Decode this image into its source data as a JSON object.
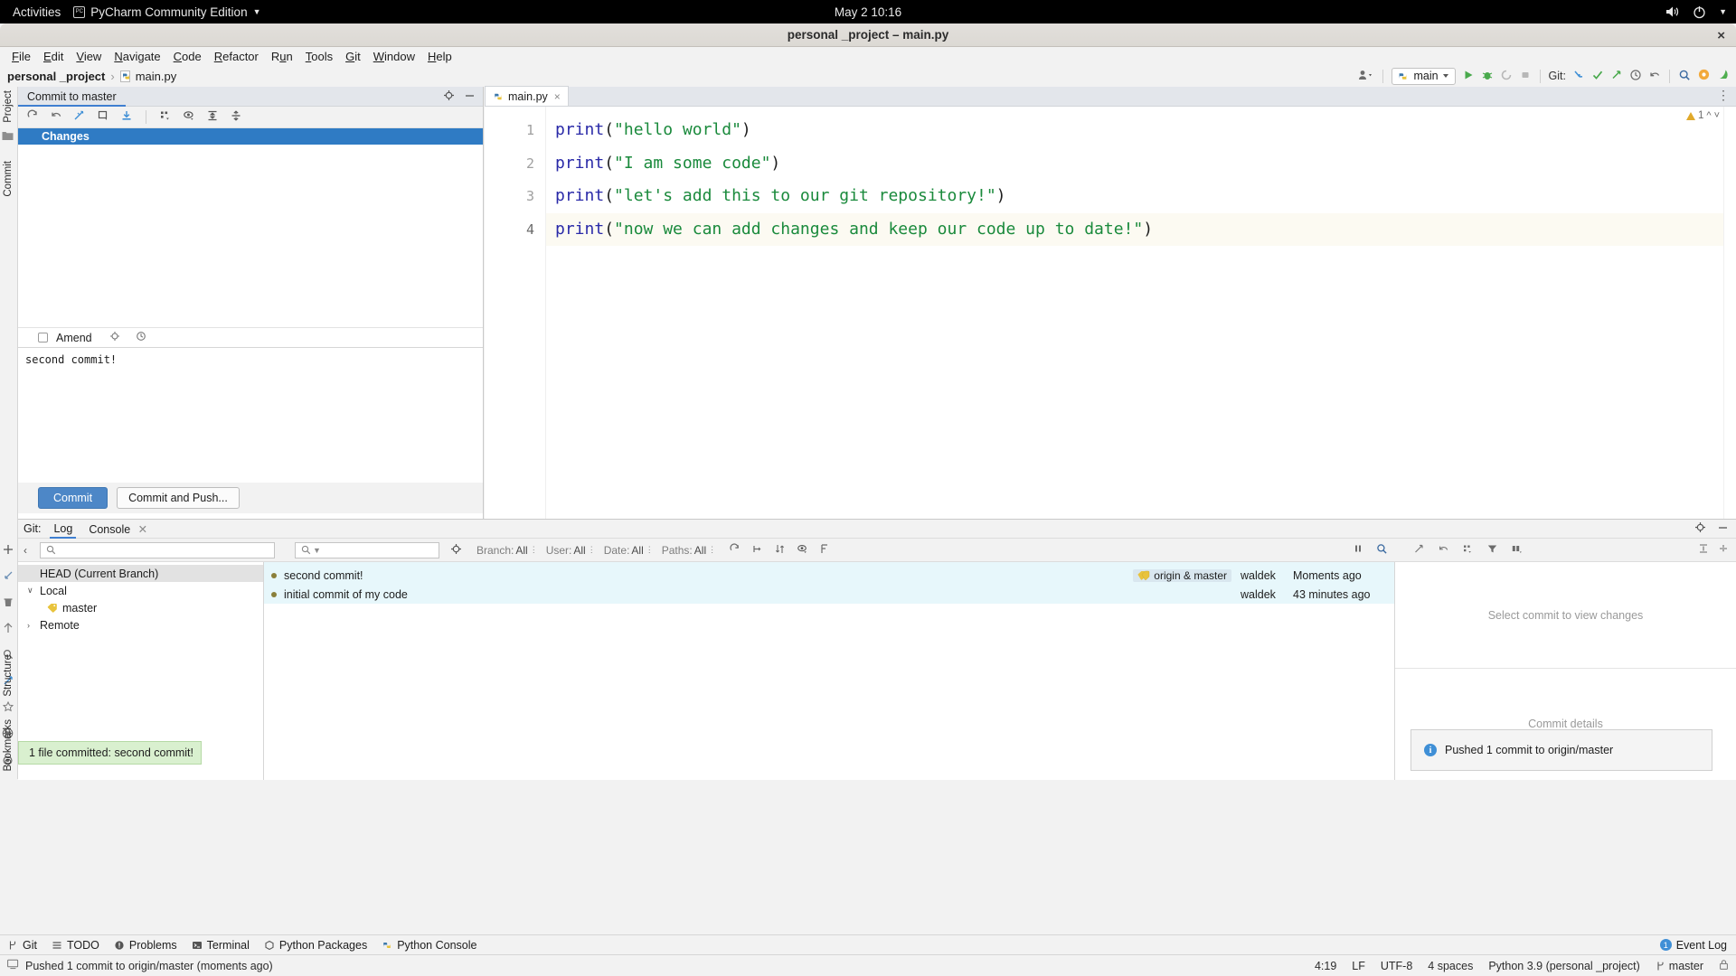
{
  "gnome": {
    "activities": "Activities",
    "app_name": "PyCharm Community Edition",
    "app_icon": "pycharm-icon",
    "clock": "May 2  10:16",
    "volume_icon": "volume-icon",
    "power_icon": "power-icon",
    "dropdown_icon": "chevron-down-icon"
  },
  "window": {
    "title": "personal _project – main.py",
    "close_label": "×"
  },
  "menubar": [
    {
      "label": "File",
      "mnemonic": "F"
    },
    {
      "label": "Edit",
      "mnemonic": "E"
    },
    {
      "label": "View",
      "mnemonic": "V"
    },
    {
      "label": "Navigate",
      "mnemonic": "N"
    },
    {
      "label": "Code",
      "mnemonic": "C"
    },
    {
      "label": "Refactor",
      "mnemonic": "R"
    },
    {
      "label": "Run",
      "mnemonic": "u"
    },
    {
      "label": "Tools",
      "mnemonic": "T"
    },
    {
      "label": "Git",
      "mnemonic": "G"
    },
    {
      "label": "Window",
      "mnemonic": "W"
    },
    {
      "label": "Help",
      "mnemonic": "H"
    }
  ],
  "breadcrumb": {
    "project": "personal _project",
    "separator": "›",
    "file": "main.py"
  },
  "toolbar": {
    "run_config": "main",
    "git_label": "Git:",
    "icons": [
      "person-dropdown-icon",
      "run-icon",
      "debug-icon",
      "coverage-icon",
      "stop-icon",
      "git-update-icon",
      "git-commit-icon",
      "git-push-icon",
      "history-icon",
      "undo-icon",
      "search-everywhere-icon",
      "settings-gear-icon",
      "ide-help-icon"
    ]
  },
  "left_rail": {
    "project_label": "Project",
    "commit_label": "Commit",
    "structure_label": "Structure",
    "bookmarks_label": "Bookmarks"
  },
  "commit_panel": {
    "tab_label": "Commit to master",
    "toolbar_icons": [
      "refresh-icon",
      "rollback-icon",
      "diff-icon",
      "show-diff-icon",
      "update-icon",
      "group-by-icon",
      "preview-icon",
      "expand-all-icon",
      "collapse-all-icon"
    ],
    "header_icons": [
      "gear-icon",
      "minimize-icon"
    ],
    "changes_header": "Changes",
    "amend_label": "Amend",
    "amend_checked": false,
    "amend_icons": [
      "gear-icon",
      "history-icon"
    ],
    "message": "second commit!",
    "commit_button": "Commit",
    "commit_push_button": "Commit and Push..."
  },
  "editor": {
    "tab": {
      "label": "main.py",
      "icon": "python-file-icon",
      "close": "×"
    },
    "warning_count": "1",
    "warning_icon": "warning-triangle-icon",
    "lines": [
      {
        "no": "1",
        "fn": "print",
        "open": "(",
        "str": "\"hello world\"",
        "close": ")",
        "active": false
      },
      {
        "no": "2",
        "fn": "print",
        "open": "(",
        "str": "\"I am some code\"",
        "close": ")",
        "active": false
      },
      {
        "no": "3",
        "fn": "print",
        "open": "(",
        "str": "\"let's add this to our git repository!\"",
        "close": ")",
        "active": false
      },
      {
        "no": "4",
        "fn": "print",
        "open": "(",
        "str": "\"now we can add changes and keep our code up to date!\"",
        "close": ")",
        "active": true
      }
    ]
  },
  "git_panel": {
    "title": "Git:",
    "tabs": [
      {
        "label": "Log",
        "selected": true,
        "closable": false
      },
      {
        "label": "Console",
        "selected": false,
        "closable": true
      }
    ],
    "header_icons": [
      "gear-icon",
      "minimize-icon"
    ],
    "branch_search_placeholder": "",
    "log_search_placeholder": "",
    "filters": [
      {
        "label": "Branch:",
        "value": "All"
      },
      {
        "label": "User:",
        "value": "All"
      },
      {
        "label": "Date:",
        "value": "All"
      },
      {
        "label": "Paths:",
        "value": "All"
      }
    ],
    "filter_icons": [
      "refresh-icon",
      "collapse-graph-icon",
      "sort-icon",
      "show-details-icon",
      "intellisort-icon"
    ],
    "right_icons": [
      "pause-icon",
      "search-icon"
    ],
    "details_icons": [
      "revert-icon",
      "undo-icon",
      "group-icon",
      "filter-icon",
      "columns-icon"
    ],
    "far_icons": [
      "expand-icon",
      "collapse-icon"
    ],
    "branch_tree": [
      {
        "label": "HEAD (Current Branch)",
        "indent": 0,
        "arrow": "",
        "selected": true,
        "icon": ""
      },
      {
        "label": "Local",
        "indent": 0,
        "arrow": "∨",
        "selected": false,
        "icon": ""
      },
      {
        "label": "master",
        "indent": 1,
        "arrow": "",
        "selected": false,
        "icon": "branch-tag-icon"
      },
      {
        "label": "Remote",
        "indent": 0,
        "arrow": "›",
        "selected": false,
        "icon": ""
      }
    ],
    "commits": [
      {
        "subject": "second commit!",
        "ref": "origin & master",
        "ref_icon": "branch-tag-icon",
        "author": "waldek",
        "when": "Moments ago"
      },
      {
        "subject": "initial commit of my code",
        "ref": "",
        "ref_icon": "",
        "author": "waldek",
        "when": "43 minutes ago"
      }
    ],
    "details_top_placeholder": "Select commit to view changes",
    "details_bottom_placeholder": "Commit details"
  },
  "toast": {
    "icon": "info-icon",
    "message": "Pushed 1 commit to origin/master"
  },
  "balloon": {
    "message": "1 file committed: second commit!"
  },
  "bottom_strip": {
    "items": [
      {
        "label": "Git",
        "icon": "git-branch-icon"
      },
      {
        "label": "TODO",
        "icon": "todo-list-icon"
      },
      {
        "label": "Problems",
        "icon": "problems-icon"
      },
      {
        "label": "Terminal",
        "icon": "terminal-icon"
      },
      {
        "label": "Python Packages",
        "icon": "packages-icon"
      },
      {
        "label": "Python Console",
        "icon": "python-console-icon"
      }
    ],
    "event_log": {
      "label": "Event Log",
      "count": "1",
      "icon": "event-log-icon"
    }
  },
  "statusbar": {
    "icon": "status-message-icon",
    "message": "Pushed 1 commit to origin/master (moments ago)",
    "caret": "4:19",
    "line_sep": "LF",
    "encoding": "UTF-8",
    "indent": "4 spaces",
    "interpreter": "Python 3.9 (personal _project)",
    "branch": "master",
    "branch_icon": "git-branch-icon",
    "lock_icon": "lock-icon"
  },
  "colors": {
    "accent_blue": "#3f7fd1",
    "changes_bar": "#2f7bc4",
    "commit_button": "#4d87c7",
    "string_green": "#1a8a3c",
    "keyword_blue": "#2a2aa8",
    "log_highlight": "#e7f7fb",
    "balloon_green": "#d9f0cf"
  }
}
